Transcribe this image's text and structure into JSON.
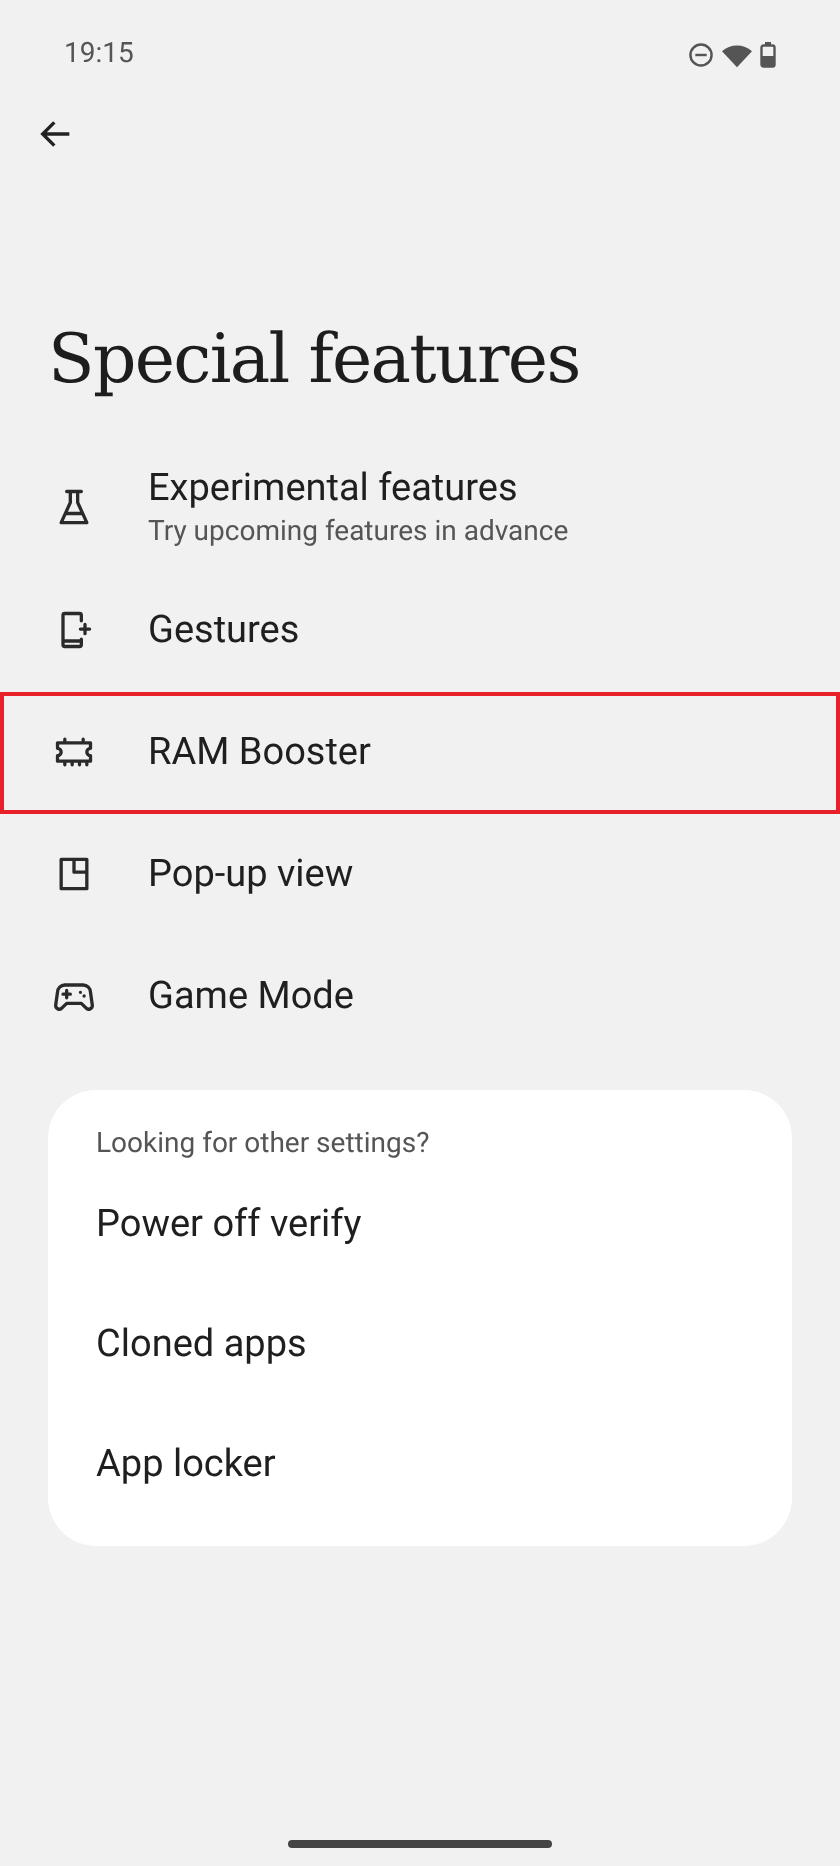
{
  "status_bar": {
    "time": "19:15"
  },
  "title": "Special features",
  "items": [
    {
      "label": "Experimental features",
      "subtitle": "Try upcoming features in advance",
      "highlighted": false
    },
    {
      "label": "Gestures",
      "highlighted": false
    },
    {
      "label": "RAM Booster",
      "highlighted": true
    },
    {
      "label": "Pop-up view",
      "highlighted": false
    },
    {
      "label": "Game Mode",
      "highlighted": false
    }
  ],
  "other_settings": {
    "heading": "Looking for other settings?",
    "items": [
      "Power off verify",
      "Cloned apps",
      "App locker"
    ]
  }
}
